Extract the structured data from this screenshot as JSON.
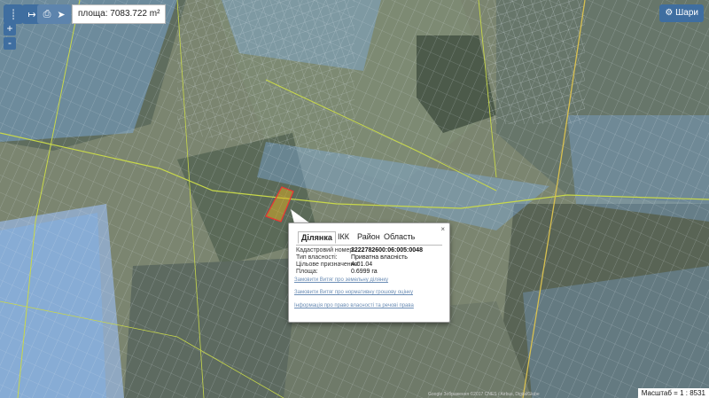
{
  "toolbar": {
    "area_prefix": "площа:",
    "area_value": "7083.722 m²"
  },
  "zoom": {
    "in_label": "+",
    "out_label": "-"
  },
  "layers": {
    "label": "Шари"
  },
  "popup": {
    "tabs": [
      "Ділянка",
      "ІКК",
      "Район",
      "Область"
    ],
    "active_tab": 0,
    "close_label": "×",
    "fields": [
      {
        "label": "Кадастровий номер:",
        "value": "3222782600:06:005:0048"
      },
      {
        "label": "Тип власності:",
        "value": "Приватна власність"
      },
      {
        "label": "Цільове призначення:",
        "value": "A.01.04"
      },
      {
        "label": "Площа:",
        "value": "0.6999 га"
      }
    ],
    "links": [
      "Замовити Витяг про земельну ділянку",
      "Замовити Витяг про нормативну грошову оцінку",
      "Інформація про право власності та речові права"
    ]
  },
  "status": {
    "scale_label": "Масштаб = 1 : 8531",
    "attribution": "Google Зображення ©2017 CNES / Airbus, DigitalGlobe"
  },
  "colors": {
    "parcel_outline": "#ffffff",
    "boundary_line": "#c8d84a",
    "selected_parcel": "#e0b020",
    "blue_overlay": "#7fb0e8",
    "accent": "#3f6ea0"
  }
}
